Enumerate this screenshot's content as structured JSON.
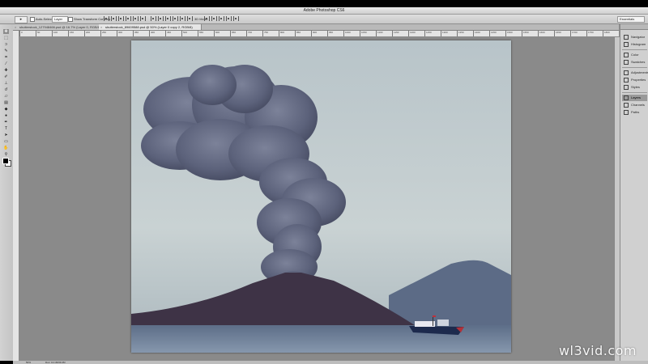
{
  "window": {
    "title": "Adobe Photoshop CS6"
  },
  "options_bar": {
    "tool_preset": "▸",
    "auto_select_label": "Auto-Select:",
    "auto_select_value": "Layer",
    "show_transform_label": "Show Transform Controls",
    "mode_3d_label": "3D Mode:",
    "workspace": "Essentials"
  },
  "tabs": [
    {
      "label": "shutterstock_127948466.psd @ 16.7% (Layer 0, RGB/8)",
      "active": false
    },
    {
      "label": "shutterstock_89609588.psd @ 50% (Layer 0 copy 2, RGB/8)",
      "active": true
    }
  ],
  "ruler_ticks": [
    "0",
    "50",
    "100",
    "150",
    "200",
    "250",
    "300",
    "350",
    "400",
    "450",
    "500",
    "550",
    "600",
    "650",
    "700",
    "750",
    "800",
    "850",
    "900",
    "950",
    "1000",
    "1050",
    "1100",
    "1150",
    "1200",
    "1250",
    "1300",
    "1350",
    "1400",
    "1450",
    "1500",
    "1550",
    "1600",
    "1650",
    "1700",
    "1750",
    "1800",
    "1850"
  ],
  "tools": [
    {
      "name": "move-tool-icon",
      "glyph": "✥",
      "selected": true
    },
    {
      "name": "marquee-tool-icon",
      "glyph": "⬚"
    },
    {
      "name": "lasso-tool-icon",
      "glyph": "ↄ"
    },
    {
      "name": "quick-select-icon",
      "glyph": "✎"
    },
    {
      "name": "crop-tool-icon",
      "glyph": "⌗"
    },
    {
      "name": "eyedropper-icon",
      "glyph": "⁄"
    },
    {
      "name": "healing-brush-icon",
      "glyph": "✚"
    },
    {
      "name": "brush-tool-icon",
      "glyph": "✐"
    },
    {
      "name": "clone-stamp-icon",
      "glyph": "⊥"
    },
    {
      "name": "history-brush-icon",
      "glyph": "↺"
    },
    {
      "name": "eraser-icon",
      "glyph": "▱"
    },
    {
      "name": "gradient-tool-icon",
      "glyph": "▤"
    },
    {
      "name": "blur-tool-icon",
      "glyph": "◆"
    },
    {
      "name": "dodge-tool-icon",
      "glyph": "●"
    },
    {
      "name": "pen-tool-icon",
      "glyph": "✒"
    },
    {
      "name": "type-tool-icon",
      "glyph": "T"
    },
    {
      "name": "path-select-icon",
      "glyph": "➤"
    },
    {
      "name": "shape-tool-icon",
      "glyph": "▭"
    },
    {
      "name": "hand-tool-icon",
      "glyph": "✋"
    },
    {
      "name": "zoom-tool-icon",
      "glyph": "⚲"
    }
  ],
  "panels": [
    {
      "label": "Navigator",
      "icon": "navigator-icon",
      "active": false
    },
    {
      "label": "Histogram",
      "icon": "histogram-icon",
      "active": false
    },
    {
      "label": "Color",
      "icon": "color-icon",
      "active": false
    },
    {
      "label": "Swatches",
      "icon": "swatches-icon",
      "active": false
    },
    {
      "label": "Adjustments",
      "icon": "adjustments-icon",
      "active": false
    },
    {
      "label": "Properties",
      "icon": "properties-icon",
      "active": false
    },
    {
      "label": "Styles",
      "icon": "styles-icon",
      "active": false
    },
    {
      "label": "Layers",
      "icon": "layers-icon",
      "active": true
    },
    {
      "label": "Channels",
      "icon": "channels-icon",
      "active": false
    },
    {
      "label": "Paths",
      "icon": "paths-icon",
      "active": false
    }
  ],
  "status": {
    "zoom": "50%",
    "doc": "Doc: 13.1M/39.4M"
  },
  "watermark": "wl3vid.com",
  "colors": {
    "foreground": "#000000",
    "background": "#ffffff",
    "canvas_bg": "#8a8a8a"
  }
}
